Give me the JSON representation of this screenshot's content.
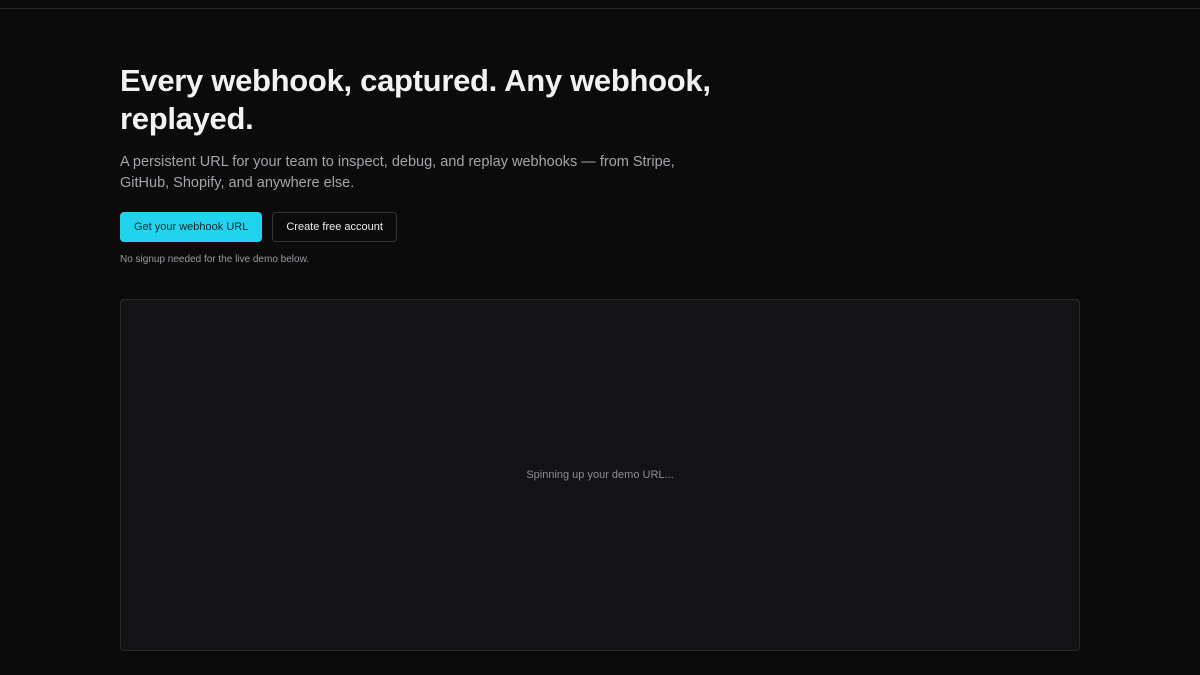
{
  "hero": {
    "title": "Every webhook, captured. Any webhook, replayed.",
    "subtitle": "A persistent URL for your team to inspect, debug, and replay webhooks — from Stripe, GitHub, Shopify, and anywhere else.",
    "primary_button_label": "Get your webhook URL",
    "secondary_button_label": "Create free account",
    "hint": "No signup needed for the live demo below."
  },
  "demo": {
    "status": "Spinning up your demo URL..."
  },
  "colors": {
    "background": "#0b0b0c",
    "accent": "#22d3ee",
    "panel": "#131315"
  }
}
